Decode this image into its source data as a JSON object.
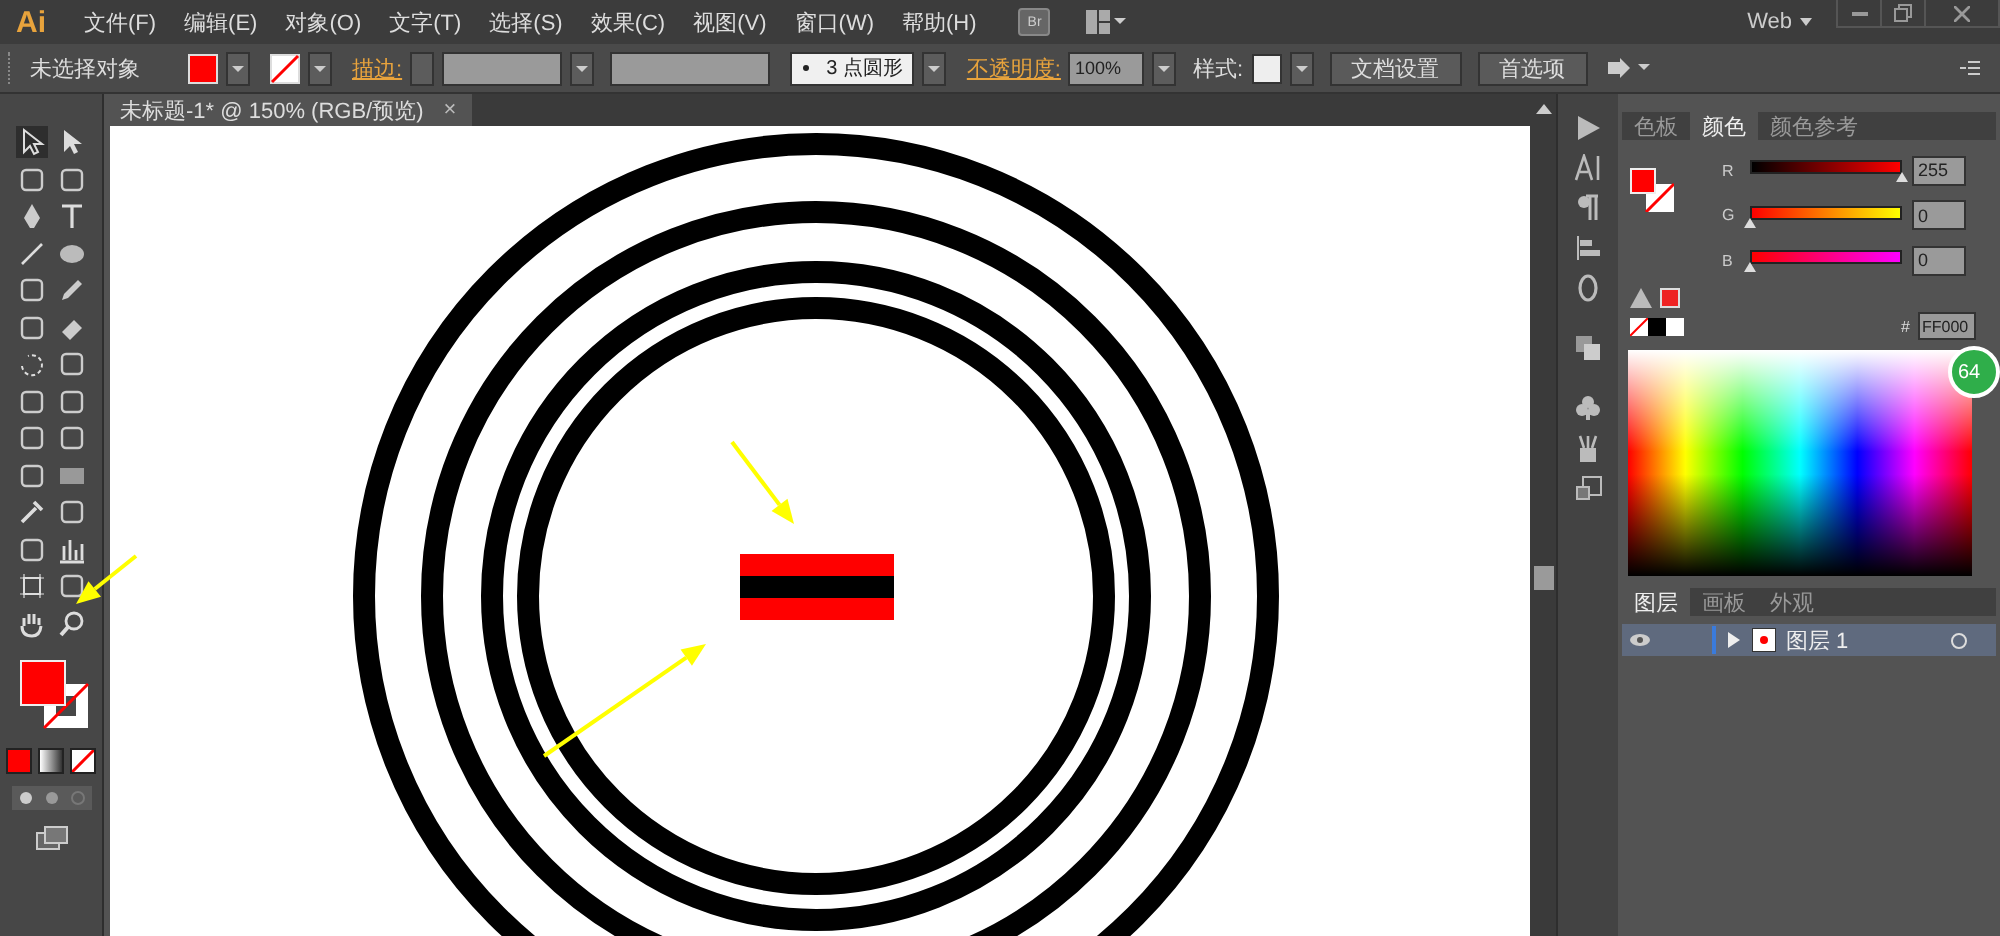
{
  "menu_bar": {
    "logo": "Ai",
    "items": [
      "文件(F)",
      "编辑(E)",
      "对象(O)",
      "文字(T)",
      "选择(S)",
      "效果(C)",
      "视图(V)",
      "窗口(W)",
      "帮助(H)"
    ],
    "bridge_label": "Br",
    "workspace": "Web"
  },
  "control_bar": {
    "selection": "未选择对象",
    "stroke_label": "描边:",
    "brush_preset": "3 点圆形",
    "opacity_label": "不透明度:",
    "opacity": "100%",
    "style_label": "样式:",
    "buttons": [
      "文档设置",
      "首选项"
    ]
  },
  "document_tab": {
    "title": "未标题-1* @ 150% (RGB/预览)",
    "close": "×"
  },
  "color_panel": {
    "tabs": [
      {
        "label": "色板",
        "selected": false
      },
      {
        "label": "颜色",
        "selected": true
      },
      {
        "label": "颜色参考",
        "selected": false
      }
    ],
    "channels": [
      {
        "name": "R",
        "level": 1,
        "reading": "255"
      },
      {
        "name": "G",
        "level": 0,
        "reading": "0"
      },
      {
        "name": "B",
        "level": 0,
        "reading": "0"
      }
    ],
    "hex_label": "#",
    "hex": "FF000"
  },
  "layers_panel": {
    "tabs": [
      {
        "label": "图层",
        "selected": true
      },
      {
        "label": "画板",
        "selected": false
      },
      {
        "label": "外观",
        "selected": false
      }
    ],
    "layers": [
      {
        "name": "图层 1",
        "visible": true,
        "expanded": false
      }
    ]
  },
  "badge": "64"
}
